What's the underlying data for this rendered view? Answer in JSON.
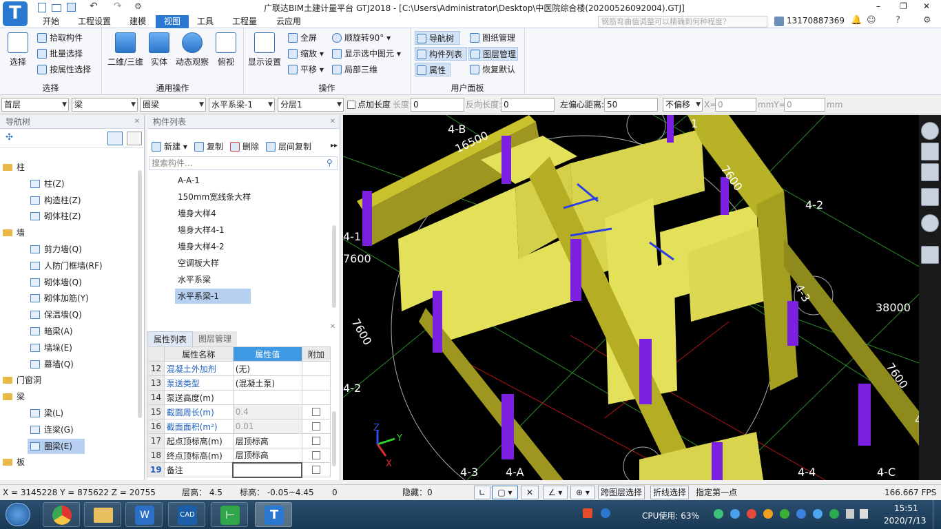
{
  "window": {
    "title": "广联达BIM土建计量平台 GTJ2018 - [C:\\Users\\Administrator\\Desktop\\中医院综合楼(20200526092004).GTJ]",
    "minimize": "–",
    "restore": "❐",
    "close": "✕"
  },
  "tabs": [
    "开始",
    "工程设置",
    "建模",
    "视图",
    "工具",
    "工程量",
    "云应用"
  ],
  "active_tab": "视图",
  "search_placeholder": "钢筋弯曲值调整可以精确到何种程度？",
  "phone": "13170887369",
  "ribbon": {
    "select_group": {
      "label": "选择",
      "big": "选择",
      "items": [
        "拾取构件",
        "批量选择",
        "按属性选择"
      ]
    },
    "common_group": {
      "label": "通用操作",
      "items": [
        "二维/三维",
        "实体",
        "动态观察",
        "俯视"
      ]
    },
    "display_group": {
      "big": "显示设置"
    },
    "ops_group": {
      "label": "操作",
      "items": [
        "全屏",
        "缩放",
        "平移",
        "顺旋转90°",
        "显示选中图元",
        "局部三维"
      ]
    },
    "user_group": {
      "label": "用户面板",
      "items": [
        "导航树",
        "构件列表",
        "属性",
        "图纸管理",
        "图层管理",
        "恢复默认"
      ]
    }
  },
  "propbar": {
    "floor": "首层",
    "type": "梁",
    "subtype": "圈梁",
    "component": "水平系梁-1",
    "layer": "分层1",
    "point_length_label": "点加长度",
    "length_label": "长度:",
    "length_value": "0",
    "reverse_label": "反向长度:",
    "reverse_value": "0",
    "offset_label": "左偏心距离:",
    "offset_value": "50",
    "no_offset": "不偏移",
    "x_label": "X=",
    "x_value": "0",
    "mm_y": "mmY=",
    "y_value": "0",
    "mm": "mm"
  },
  "nav": {
    "title": "导航树",
    "groups": [
      {
        "label": "柱",
        "children": [
          "柱(Z)",
          "构造柱(Z)",
          "砌体柱(Z)"
        ]
      },
      {
        "label": "墙",
        "children": [
          "剪力墙(Q)",
          "人防门框墙(RF)",
          "砌体墙(Q)",
          "砌体加筋(Y)",
          "保温墙(Q)",
          "暗梁(A)",
          "墙垛(E)",
          "幕墙(Q)"
        ]
      },
      {
        "label": "门窗洞",
        "children": []
      },
      {
        "label": "梁",
        "children": [
          "梁(L)",
          "连梁(G)",
          "圈梁(E)"
        ]
      },
      {
        "label": "板",
        "children": []
      }
    ]
  },
  "components": {
    "title": "构件列表",
    "toolbar": [
      "新建",
      "复制",
      "删除",
      "层间复制"
    ],
    "search_placeholder": "搜索构件...",
    "items": [
      "A-A-1",
      "150mm宽线条大样",
      "墙身大样4",
      "墙身大样4-1",
      "墙身大样4-2",
      "空调板大样",
      "水平系梁",
      "水平系梁-1"
    ],
    "selected": "水平系梁-1"
  },
  "properties": {
    "tabs": [
      "属性列表",
      "图层管理"
    ],
    "headers": [
      "属性名称",
      "属性值",
      "附加"
    ],
    "rows": [
      {
        "num": "12",
        "name": "混凝土外加剂",
        "value": "(无)",
        "blue": true,
        "check": false
      },
      {
        "num": "13",
        "name": "泵送类型",
        "value": "(混凝土泵)",
        "blue": true,
        "check": false
      },
      {
        "num": "14",
        "name": "泵送高度(m)",
        "value": "",
        "blue": false,
        "check": false
      },
      {
        "num": "15",
        "name": "截面周长(m)",
        "value": "0.4",
        "blue": true,
        "check": true
      },
      {
        "num": "16",
        "name": "截面面积(m²)",
        "value": "0.01",
        "blue": true,
        "check": true
      },
      {
        "num": "17",
        "name": "起点顶标高(m)",
        "value": "层顶标高",
        "blue": false,
        "check": true
      },
      {
        "num": "18",
        "name": "终点顶标高(m)",
        "value": "层顶标高",
        "blue": false,
        "check": true
      },
      {
        "num": "19",
        "name": "备注",
        "value": "",
        "blue": false,
        "check": true
      }
    ]
  },
  "viewport": {
    "labels": [
      "4-B",
      "16500",
      "1",
      "7600",
      "4-2",
      "4-1",
      "7600",
      "7600",
      "4-3",
      "38000",
      "7600",
      "4-2",
      "7600",
      "4-4",
      "4-3",
      "4-A",
      "4-4",
      "4-C"
    ],
    "axis": {
      "x": "X",
      "y": "Y",
      "z": "Z"
    }
  },
  "status": {
    "coords": "X = 3145228 Y = 875622 Z = 20755",
    "floor_height": "层高：  4.5",
    "elevation": "标高：  -0.05~4.45",
    "zero": "0",
    "hidden": "隐藏：0",
    "cross_layer": "跨图层选择",
    "polyline": "折线选择",
    "hint": "指定第一点",
    "fps": "166.667 FPS"
  },
  "taskbar": {
    "apps": [
      "chrome",
      "explorer",
      "wps",
      "cad",
      "gld",
      "gtj"
    ],
    "cpu": "CPU使用: 63%",
    "time": "15:51",
    "date": "2020/7/13"
  }
}
